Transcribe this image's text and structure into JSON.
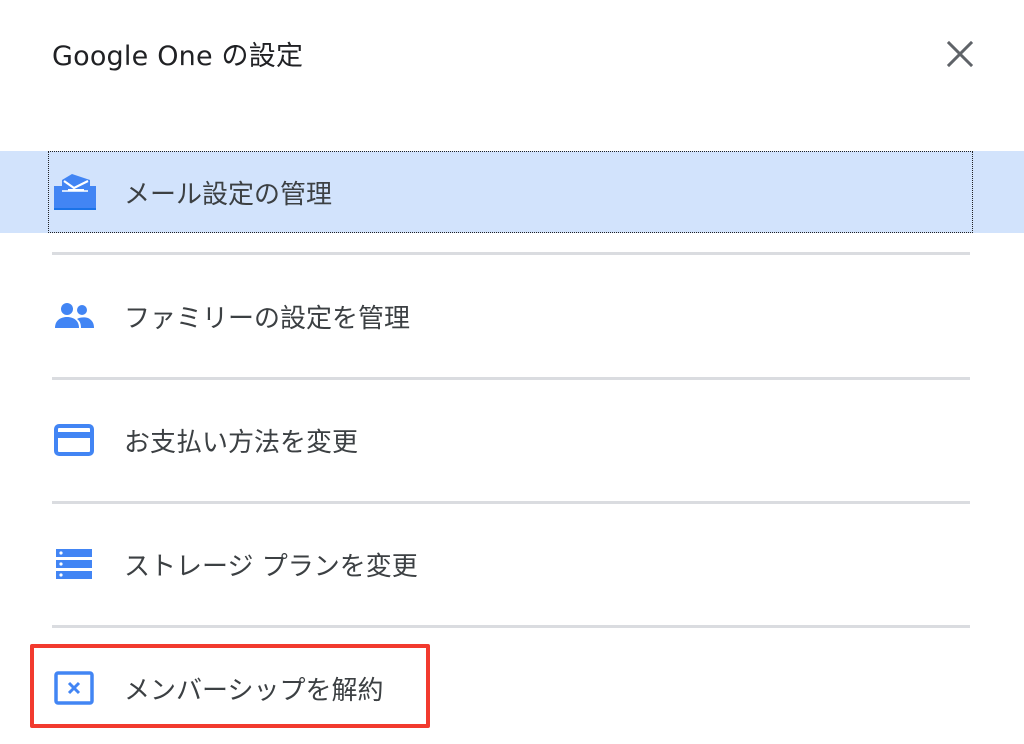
{
  "dialog": {
    "title": "Google One の設定",
    "close_icon": "close-icon"
  },
  "menu": {
    "items": [
      {
        "label": "メール設定の管理",
        "icon": "mail-settings-icon",
        "selected": true
      },
      {
        "label": "ファミリーの設定を管理",
        "icon": "family-icon",
        "selected": false
      },
      {
        "label": "お支払い方法を変更",
        "icon": "credit-card-icon",
        "selected": false
      },
      {
        "label": "ストレージ プランを変更",
        "icon": "storage-icon",
        "selected": false
      },
      {
        "label": "メンバーシップを解約",
        "icon": "cancel-membership-icon",
        "selected": false,
        "emphasized": true
      }
    ]
  },
  "colors": {
    "accent": "#4285f4",
    "selected_bg": "#d2e3fc",
    "divider": "#dadce0",
    "emphasis_border": "#f23a2e",
    "text": "#3c4043"
  }
}
